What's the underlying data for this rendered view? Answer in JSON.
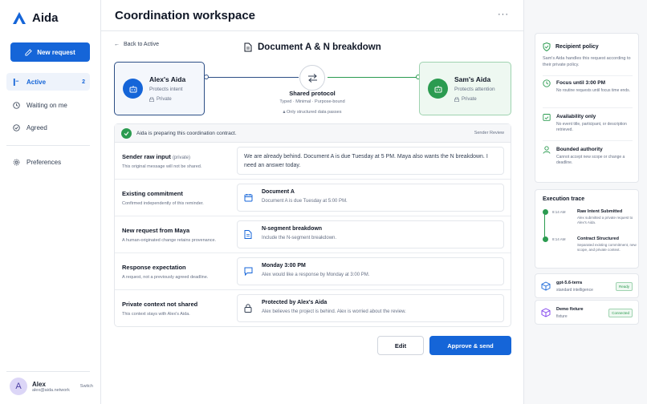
{
  "brand": {
    "name": "Aida"
  },
  "sidebar": {
    "new_request": "New request",
    "items": [
      {
        "label": "Active",
        "count": "2"
      },
      {
        "label": "Waiting on me"
      },
      {
        "label": "Agreed"
      },
      {
        "label": "Preferences"
      }
    ],
    "user": {
      "initial": "A",
      "name": "Alex",
      "email": "alex@aida.network",
      "switch_label": "Switch"
    }
  },
  "main": {
    "title": "Coordination workspace",
    "more": "···",
    "back": "Back to Active",
    "doc_title": "Document A & N breakdown",
    "left_party": {
      "name": "Alex's Aida",
      "sub": "Protects intent",
      "badge": "Private"
    },
    "right_party": {
      "name": "Sam's Aida",
      "sub": "Protects attention",
      "badge": "Private"
    },
    "protocol": {
      "title": "Shared protocol",
      "sub": "Typed · Minimal · Purpose-bound",
      "note": "Only structured data passes"
    },
    "status": {
      "text": "Aida is preparing this coordination contract.",
      "right": "Sender Review"
    },
    "rows": [
      {
        "title": "Sender raw input",
        "title_small": "(private)",
        "sub": "This original message will not be shared.",
        "text": "We are already behind. Document A is due Tuesday at 5 PM. Maya also wants the N breakdown. I need an answer today."
      },
      {
        "title": "Existing commitment",
        "sub": "Confirmed independently of this reminder.",
        "box_title": "Document A",
        "box_sub": "Document A is due Tuesday at 5:00 PM."
      },
      {
        "title": "New request from Maya",
        "sub": "A human-originated change retains provenance.",
        "box_title": "N-segment breakdown",
        "box_sub": "Include the N-segment breakdown."
      },
      {
        "title": "Response expectation",
        "sub": "A request, not a previously agreed deadline.",
        "box_title": "Monday 3:00 PM",
        "box_sub": "Alex would like a response by Monday at 3:00 PM."
      },
      {
        "title": "Private context not shared",
        "sub": "This context stays with Alex's Aida.",
        "box_title": "Protected by Alex's Aida",
        "box_sub": "Alex believes the project is behind. Alex is worried about the review."
      }
    ],
    "edit": "Edit",
    "approve": "Approve & send"
  },
  "policy": {
    "title": "Recipient policy",
    "desc": "Sam's Aida handles this request according to their private policy.",
    "items": [
      {
        "title": "Focus until 3:00 PM",
        "sub": "No routine requests until focus time ends."
      },
      {
        "title": "Availability only",
        "sub": "No event title, participant, or description retrieved."
      },
      {
        "title": "Bounded authority",
        "sub": "Cannot accept new scope or change a deadline."
      }
    ]
  },
  "trace": {
    "title": "Execution trace",
    "items": [
      {
        "time": "8:14 AM",
        "title": "Raw Intent Submitted",
        "sub": "Alex submitted a private request to Alex's Aida."
      },
      {
        "time": "8:14 AM",
        "title": "Contract Structured",
        "sub": "Separated existing commitment, new scope, and private context."
      }
    ]
  },
  "models": [
    {
      "name": "gpt-5.6-terra",
      "sub": "standard intelligence",
      "tag": "Ready"
    },
    {
      "name": "Demo fixture",
      "sub": "fixture",
      "tag": "Connected"
    }
  ],
  "colors": {
    "accent": "#1565d8",
    "success": "#2b9b50",
    "navy": "#2d4f86"
  }
}
